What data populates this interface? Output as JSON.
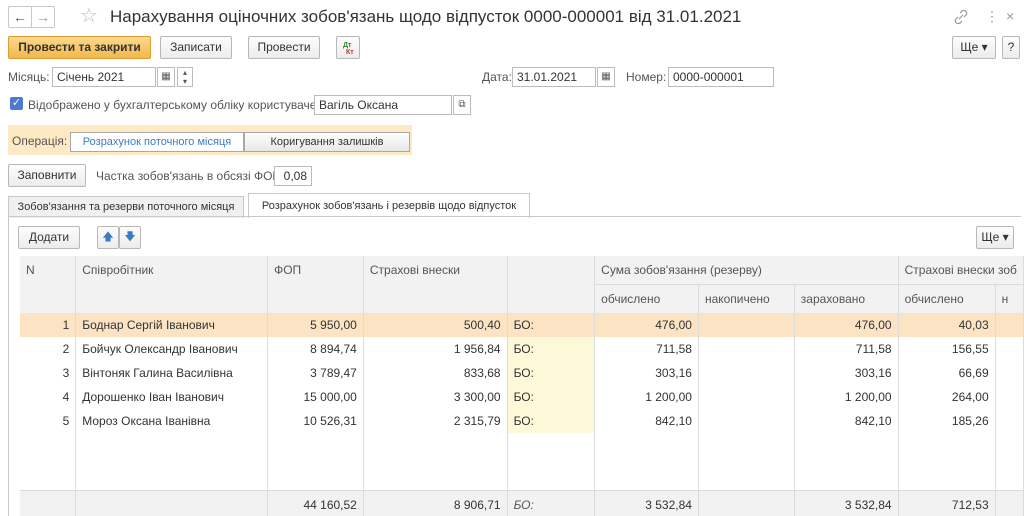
{
  "window": {
    "title": "Нарахування оціночних зобов'язань щодо відпусток 0000-000001 від 31.01.2021",
    "link_icon": "link-icon",
    "more_icon": "⋮",
    "close_icon": "×"
  },
  "toolbar": {
    "post_close": "Провести та закрити",
    "save": "Записати",
    "post": "Провести",
    "more": "Ще ▾",
    "help": "?"
  },
  "header": {
    "month_label": "Місяць:",
    "month_value": "Січень 2021",
    "date_label": "Дата:",
    "date_value": "31.01.2021",
    "number_label": "Номер:",
    "number_value": "0000-000001",
    "reflected_label": "Відображено у бухгалтерському обліку користувачем",
    "user_value": "Вагіль Оксана"
  },
  "operation": {
    "label": "Операція:",
    "options": [
      "Розрахунок поточного місяця",
      "Коригування залишків"
    ],
    "selected": 0
  },
  "fill": {
    "button": "Заповнити",
    "share_label": "Частка зобов'язань в обсязі ФОП:",
    "share_value": "0,08"
  },
  "tabs": [
    "Зобов'язання та резерви поточного місяця",
    "Розрахунок зобов'язань і резервів щодо відпусток"
  ],
  "table_toolbar": {
    "add": "Додати",
    "more": "Ще ▾"
  },
  "table": {
    "headers": {
      "n": "N",
      "employee": "Співробітник",
      "fop": "ФОП",
      "insurance": "Страхові внески",
      "sum_group": "Сума зобов'язання (резерву)",
      "computed": "обчислено",
      "accumulated": "накопичено",
      "accrued": "зараховано",
      "ins_group": "Страхові внески зоб",
      "ins_computed": "обчислено",
      "ins_next": "н"
    },
    "rows": [
      {
        "n": "1",
        "employee": "Боднар Сергій Іванович",
        "fop": "5 950,00",
        "ins": "500,40",
        "bo": "БО:",
        "computed": "476,00",
        "accumulated": "",
        "accrued": "476,00",
        "ins_computed": "40,03"
      },
      {
        "n": "2",
        "employee": "Бойчук Олександр Іванович",
        "fop": "8 894,74",
        "ins": "1 956,84",
        "bo": "БО:",
        "computed": "711,58",
        "accumulated": "",
        "accrued": "711,58",
        "ins_computed": "156,55"
      },
      {
        "n": "3",
        "employee": "Вінтоняк Галина Василівна",
        "fop": "3 789,47",
        "ins": "833,68",
        "bo": "БО:",
        "computed": "303,16",
        "accumulated": "",
        "accrued": "303,16",
        "ins_computed": "66,69"
      },
      {
        "n": "4",
        "employee": "Дорошенко Іван Іванович",
        "fop": "15 000,00",
        "ins": "3 300,00",
        "bo": "БО:",
        "computed": "1 200,00",
        "accumulated": "",
        "accrued": "1 200,00",
        "ins_computed": "264,00"
      },
      {
        "n": "5",
        "employee": "Мороз Оксана Іванівна",
        "fop": "10 526,31",
        "ins": "2 315,79",
        "bo": "БО:",
        "computed": "842,10",
        "accumulated": "",
        "accrued": "842,10",
        "ins_computed": "185,26"
      }
    ],
    "totals": {
      "fop": "44 160,52",
      "ins": "8 906,71",
      "bo": "БО:",
      "computed": "3 532,84",
      "accrued": "3 532,84",
      "ins_computed": "712,53"
    }
  }
}
